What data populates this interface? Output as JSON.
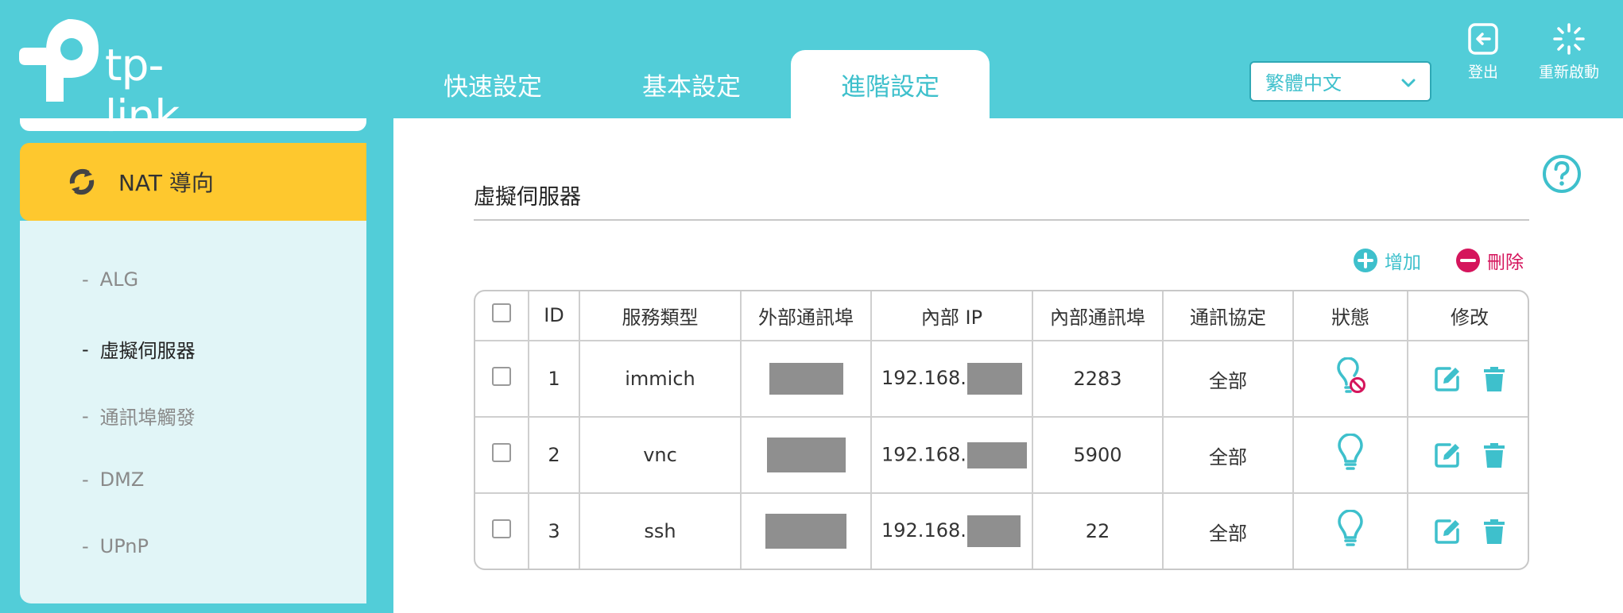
{
  "brand": {
    "name": "tp-link"
  },
  "tabs": [
    {
      "label": "快速設定"
    },
    {
      "label": "基本設定"
    },
    {
      "label": "進階設定",
      "active": true
    }
  ],
  "language": {
    "selected": "繁體中文"
  },
  "header_buttons": {
    "logout": "登出",
    "reboot": "重新啟動"
  },
  "sidebar": {
    "active": {
      "label": "NAT 導向",
      "icon": "nat-forwarding-icon"
    },
    "items": [
      {
        "label": "ALG"
      },
      {
        "label": "虛擬伺服器",
        "active": true
      },
      {
        "label": "通訊埠觸發"
      },
      {
        "label": "DMZ"
      },
      {
        "label": "UPnP"
      }
    ]
  },
  "main": {
    "title": "虛擬伺服器",
    "actions": {
      "add": "增加",
      "delete": "刪除"
    },
    "table": {
      "headers": [
        "ID",
        "服務類型",
        "外部通訊埠",
        "內部 IP",
        "內部通訊埠",
        "通訊協定",
        "狀態",
        "修改"
      ],
      "rows": [
        {
          "id": "1",
          "service": "immich",
          "internal_ip_prefix": "192.168.",
          "internal_port": "2283",
          "protocol": "全部",
          "status": "disabled"
        },
        {
          "id": "2",
          "service": "vnc",
          "internal_ip_prefix": "192.168.",
          "internal_port": "5900",
          "protocol": "全部",
          "status": "enabled"
        },
        {
          "id": "3",
          "service": "ssh",
          "internal_ip_prefix": "192.168.",
          "internal_port": "22",
          "protocol": "全部",
          "status": "enabled"
        }
      ]
    }
  },
  "colors": {
    "header_bg": "#52cdd8",
    "accent": "#3ec0cc",
    "active_nav": "#fec82e",
    "delete": "#d5155c"
  }
}
